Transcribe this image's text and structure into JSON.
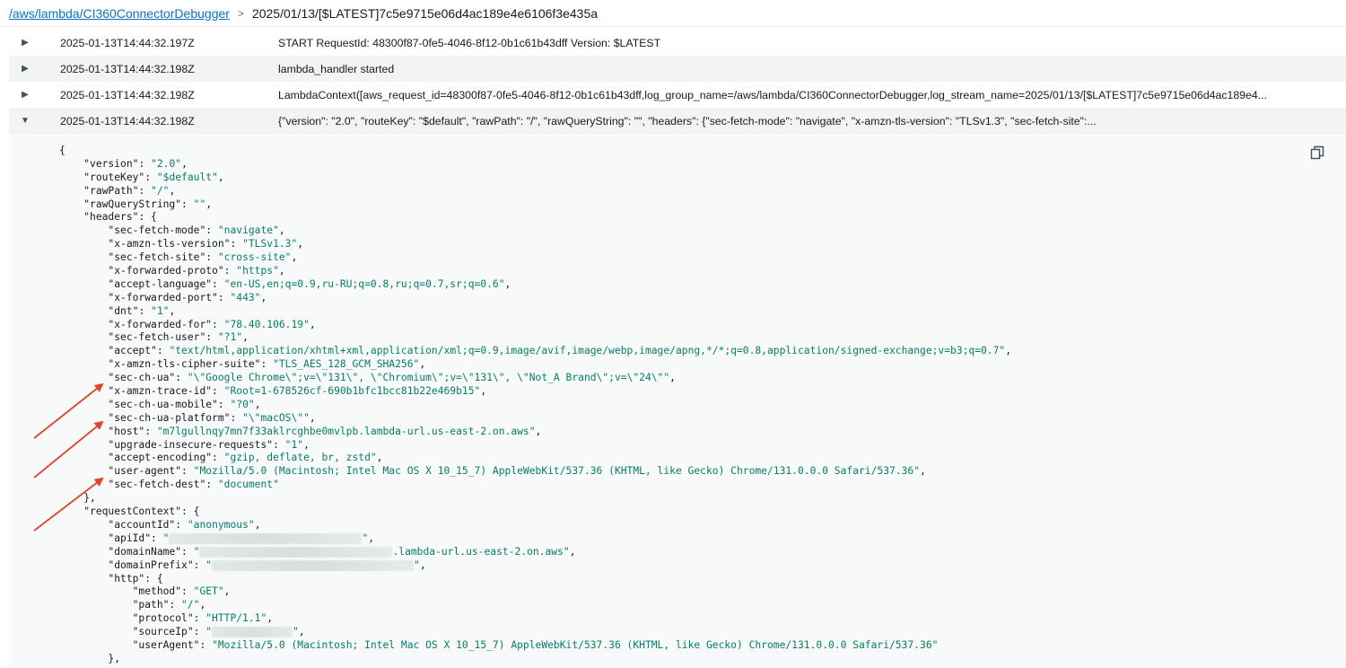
{
  "breadcrumb": {
    "log_group": "/aws/lambda/CI360ConnectorDebugger",
    "separator": ">",
    "log_stream": "2025/01/13/[$LATEST]7c5e9715e06d4ac189e4e6106f3e435a"
  },
  "log_events": [
    {
      "timestamp": "2025-01-13T14:44:32.197Z",
      "message": "START RequestId: 48300f87-0fe5-4046-8f12-0b1c61b43dff Version: $LATEST",
      "caret": "▶"
    },
    {
      "timestamp": "2025-01-13T14:44:32.198Z",
      "message": "lambda_handler started",
      "caret": "▶"
    },
    {
      "timestamp": "2025-01-13T14:44:32.198Z",
      "message": "LambdaContext([aws_request_id=48300f87-0fe5-4046-8f12-0b1c61b43dff,log_group_name=/aws/lambda/CI360ConnectorDebugger,log_stream_name=2025/01/13/[$LATEST]7c5e9715e06d4ac189e4...",
      "caret": "▶"
    },
    {
      "timestamp": "2025-01-13T14:44:32.198Z",
      "message": "{\"version\": \"2.0\", \"routeKey\": \"$default\", \"rawPath\": \"/\", \"rawQueryString\": \"\", \"headers\": {\"sec-fetch-mode\": \"navigate\", \"x-amzn-tls-version\": \"TLSv1.3\", \"sec-fetch-site\":...",
      "caret": "▼"
    }
  ],
  "expanded_json": [
    {
      "indent": 0,
      "key": "",
      "value": "",
      "open": "{",
      "close": ""
    },
    {
      "indent": 1,
      "key": "\"version\"",
      "value": "\"2.0\"",
      "open": "",
      "close": ","
    },
    {
      "indent": 1,
      "key": "\"routeKey\"",
      "value": "\"$default\"",
      "open": "",
      "close": ","
    },
    {
      "indent": 1,
      "key": "\"rawPath\"",
      "value": "\"/\"",
      "open": "",
      "close": ","
    },
    {
      "indent": 1,
      "key": "\"rawQueryString\"",
      "value": "\"\"",
      "open": "",
      "close": ","
    },
    {
      "indent": 1,
      "key": "\"headers\"",
      "value": "",
      "open": "{",
      "close": ""
    },
    {
      "indent": 2,
      "key": "\"sec-fetch-mode\"",
      "value": "\"navigate\"",
      "open": "",
      "close": ","
    },
    {
      "indent": 2,
      "key": "\"x-amzn-tls-version\"",
      "value": "\"TLSv1.3\"",
      "open": "",
      "close": ","
    },
    {
      "indent": 2,
      "key": "\"sec-fetch-site\"",
      "value": "\"cross-site\"",
      "open": "",
      "close": ","
    },
    {
      "indent": 2,
      "key": "\"x-forwarded-proto\"",
      "value": "\"https\"",
      "open": "",
      "close": ","
    },
    {
      "indent": 2,
      "key": "\"accept-language\"",
      "value": "\"en-US,en;q=0.9,ru-RU;q=0.8,ru;q=0.7,sr;q=0.6\"",
      "open": "",
      "close": ","
    },
    {
      "indent": 2,
      "key": "\"x-forwarded-port\"",
      "value": "\"443\"",
      "open": "",
      "close": ","
    },
    {
      "indent": 2,
      "key": "\"dnt\"",
      "value": "\"1\"",
      "open": "",
      "close": ","
    },
    {
      "indent": 2,
      "key": "\"x-forwarded-for\"",
      "value": "\"78.40.106.19\"",
      "open": "",
      "close": ","
    },
    {
      "indent": 2,
      "key": "\"sec-fetch-user\"",
      "value": "\"?1\"",
      "open": "",
      "close": ","
    },
    {
      "indent": 2,
      "key": "\"accept\"",
      "value": "\"text/html,application/xhtml+xml,application/xml;q=0.9,image/avif,image/webp,image/apng,*/*;q=0.8,application/signed-exchange;v=b3;q=0.7\"",
      "open": "",
      "close": ","
    },
    {
      "indent": 2,
      "key": "\"x-amzn-tls-cipher-suite\"",
      "value": "\"TLS_AES_128_GCM_SHA256\"",
      "open": "",
      "close": ","
    },
    {
      "indent": 2,
      "key": "\"sec-ch-ua\"",
      "value": "\"\\\"Google Chrome\\\";v=\\\"131\\\", \\\"Chromium\\\";v=\\\"131\\\", \\\"Not_A Brand\\\";v=\\\"24\\\"\"",
      "open": "",
      "close": ","
    },
    {
      "indent": 2,
      "key": "\"x-amzn-trace-id\"",
      "value": "\"Root=1-678526cf-690b1bfc1bcc81b22e469b15\"",
      "open": "",
      "close": ","
    },
    {
      "indent": 2,
      "key": "\"sec-ch-ua-mobile\"",
      "value": "\"?0\"",
      "open": "",
      "close": ","
    },
    {
      "indent": 2,
      "key": "\"sec-ch-ua-platform\"",
      "value": "\"\\\"macOS\\\"\"",
      "open": "",
      "close": ","
    },
    {
      "indent": 2,
      "key": "\"host\"",
      "value": "\"m7lgullnqy7mn7f33aklrcghbe0mvlpb.lambda-url.us-east-2.on.aws\"",
      "open": "",
      "close": ","
    },
    {
      "indent": 2,
      "key": "\"upgrade-insecure-requests\"",
      "value": "\"1\"",
      "open": "",
      "close": ","
    },
    {
      "indent": 2,
      "key": "\"accept-encoding\"",
      "value": "\"gzip, deflate, br, zstd\"",
      "open": "",
      "close": ","
    },
    {
      "indent": 2,
      "key": "\"user-agent\"",
      "value": "\"Mozilla/5.0 (Macintosh; Intel Mac OS X 10_15_7) AppleWebKit/537.36 (KHTML, like Gecko) Chrome/131.0.0.0 Safari/537.36\"",
      "open": "",
      "close": ","
    },
    {
      "indent": 2,
      "key": "\"sec-fetch-dest\"",
      "value": "\"document\"",
      "open": "",
      "close": ""
    },
    {
      "indent": 1,
      "key": "",
      "value": "",
      "open": "",
      "close": "},"
    },
    {
      "indent": 1,
      "key": "\"requestContext\"",
      "value": "",
      "open": "{",
      "close": ""
    },
    {
      "indent": 2,
      "key": "\"accountId\"",
      "value": "\"anonymous\"",
      "open": "",
      "close": ","
    },
    {
      "indent": 2,
      "key": "\"apiId\"",
      "value": "\"",
      "redacted": 1,
      "value_end": "\"",
      "open": "",
      "close": ","
    },
    {
      "indent": 2,
      "key": "\"domainName\"",
      "value": "\"",
      "redacted": 2,
      "value_end": ".lambda-url.us-east-2.on.aws\"",
      "open": "",
      "close": ","
    },
    {
      "indent": 2,
      "key": "\"domainPrefix\"",
      "value": "\"",
      "redacted": 3,
      "value_end": "\"",
      "open": "",
      "close": ","
    },
    {
      "indent": 2,
      "key": "\"http\"",
      "value": "",
      "open": "{",
      "close": ""
    },
    {
      "indent": 3,
      "key": "\"method\"",
      "value": "\"GET\"",
      "open": "",
      "close": ","
    },
    {
      "indent": 3,
      "key": "\"path\"",
      "value": "\"/\"",
      "open": "",
      "close": ","
    },
    {
      "indent": 3,
      "key": "\"protocol\"",
      "value": "\"HTTP/1.1\"",
      "open": "",
      "close": ","
    },
    {
      "indent": 3,
      "key": "\"sourceIp\"",
      "value": "\"",
      "redacted": 4,
      "value_end": "\"",
      "open": "",
      "close": ","
    },
    {
      "indent": 3,
      "key": "\"userAgent\"",
      "value": "\"Mozilla/5.0 (Macintosh; Intel Mac OS X 10_15_7) AppleWebKit/537.36 (KHTML, like Gecko) Chrome/131.0.0.0 Safari/537.36\"",
      "open": "",
      "close": ""
    },
    {
      "indent": 2,
      "key": "",
      "value": "",
      "open": "",
      "close": "},"
    }
  ],
  "copy_icon": "copy-icon",
  "colors": {
    "link": "#0972d3",
    "string_value": "#037f6a",
    "annotation_arrow": "#e8412c",
    "row_shade": "#f2f3f3"
  }
}
